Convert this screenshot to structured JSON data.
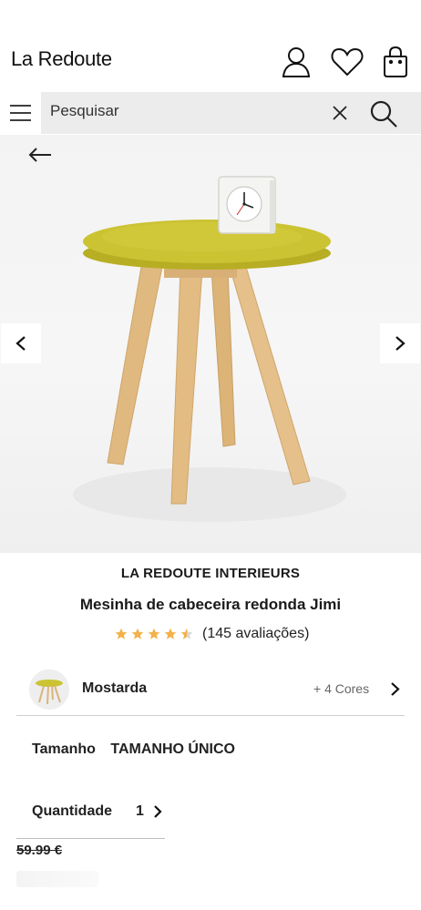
{
  "header": {
    "logo": "La Redoute",
    "icons": [
      "account-icon",
      "wishlist-heart-icon",
      "shopping-bag-icon"
    ]
  },
  "search": {
    "placeholder": "Pesquisar",
    "icons": [
      "menu-icon",
      "close-icon",
      "search-icon"
    ]
  },
  "gallery": {
    "back_icon": "back-arrow-icon",
    "prev_icon": "chevron-left-icon",
    "next_icon": "chevron-right-icon"
  },
  "product": {
    "brand": "LA REDOUTE INTERIEURS",
    "title": "Mesinha de cabeceira redonda Jimi",
    "rating": 4.5,
    "rating_max": 5,
    "reviews": "(145 avaliações)"
  },
  "color": {
    "selected": "Mostarda",
    "more": "+ 4 Cores"
  },
  "size": {
    "label": "Tamanho",
    "value": "TAMANHO ÚNICO"
  },
  "quantity": {
    "label": "Quantidade",
    "value": "1"
  },
  "price": {
    "old": "59.99 €"
  },
  "colors": {
    "star": "#f2b24a",
    "star_empty": "#d8d8d8",
    "tabletop": "#c9c12f",
    "wood": "#e2bd85"
  }
}
